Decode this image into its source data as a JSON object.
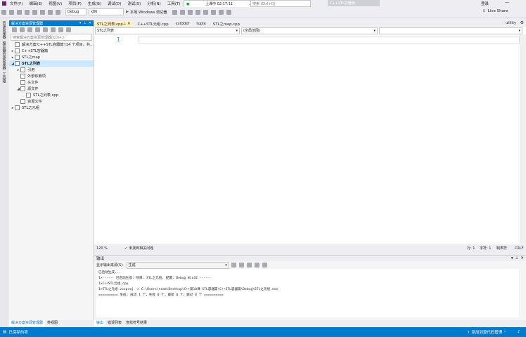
{
  "menu": [
    "文件(F)",
    "编辑(E)",
    "视图(V)",
    "项目(P)",
    "生成(B)",
    "调试(D)",
    "测试(S)",
    "分析(N)",
    "工具(T)"
  ],
  "recording": {
    "status": "上课中 02:17:11",
    "chevron": "⌄"
  },
  "search_placeholder": "搜索 (Ctrl+Q)",
  "title_tag": "C++STL容器篇",
  "login": "登录",
  "live_share": "Live Share",
  "toolbar": {
    "config": "Debug",
    "platform": "x86",
    "run_label": "本地 Windows 调试器"
  },
  "left_strip": [
    "资源管理器",
    "服务器资源管理器",
    "工具箱"
  ],
  "solution_explorer": {
    "title": "解决方案资源管理器",
    "search_placeholder": "搜索解决方案资源管理器(Ctrl+;)",
    "tree": [
      {
        "label": "解决方案'C++STL容器篇'(14 个项目，共...",
        "arrow": "",
        "depth": 0,
        "sel": false
      },
      {
        "label": "C++STL容器篇",
        "arrow": "▸",
        "depth": 0,
        "sel": false
      },
      {
        "label": "STL之map",
        "arrow": "▸",
        "depth": 0,
        "sel": false
      },
      {
        "label": "STL之列表",
        "arrow": "◢",
        "depth": 0,
        "sel": true
      },
      {
        "label": "引用",
        "arrow": "▸",
        "depth": 1,
        "sel": false
      },
      {
        "label": "外部依赖项",
        "arrow": "",
        "depth": 1,
        "sel": false
      },
      {
        "label": "头文件",
        "arrow": "",
        "depth": 1,
        "sel": false
      },
      {
        "label": "源文件",
        "arrow": "◢",
        "depth": 1,
        "sel": false
      },
      {
        "label": "STL之列表.cpp",
        "arrow": "",
        "depth": 2,
        "sel": false
      },
      {
        "label": "资源文件",
        "arrow": "",
        "depth": 1,
        "sel": false
      },
      {
        "label": "STL之元组",
        "arrow": "▸",
        "depth": 0,
        "sel": false
      }
    ],
    "bottom_tabs": [
      "解决方案资源管理器",
      "类视图"
    ]
  },
  "doc_tabs": [
    {
      "label": "STL之列表.cpp",
      "active": true
    },
    {
      "label": "C++STL元组.cpp",
      "active": false
    },
    {
      "label": "xstddef",
      "active": false
    },
    {
      "label": "tuple",
      "active": false
    },
    {
      "label": "STL之map.cpp",
      "active": false
    }
  ],
  "utility_tab": "utility",
  "editor": {
    "nav_project": "STL之列表",
    "nav_scope": "(全局范围)",
    "line_number": "1",
    "zoom": "120 %",
    "issues": "未找到相关问题",
    "position": "行: 1",
    "col": "字符: 1",
    "mode": "制表符",
    "eol": "CRLF"
  },
  "output": {
    "title": "输出",
    "source_label": "显示输出来源(S):",
    "source_value": "生成",
    "lines": [
      "已启动生成...",
      "1>------ 已启动生成: 项目: STL之元组, 配置: Debug Win32 ------",
      "1>C++STL元组.cpp",
      "1>STL之元组.vcxproj -> C:\\Users\\team\\Desktop\\C++第10课 STL容器篇\\C++STL容器篇\\Debug\\STL之元组.exe",
      "========== 生成: 成功 1 个，失败 0 个，最新 0 个，跳过 0 个 =========="
    ],
    "tabs": [
      "输出",
      "错误列表",
      "查找符号结果"
    ]
  },
  "status": {
    "left": "已保存的项",
    "right": "添加到源代码管理"
  },
  "colors": {
    "accent": "#007acc",
    "active_tab": "#fff0c2",
    "selection": "#cce8ff"
  }
}
